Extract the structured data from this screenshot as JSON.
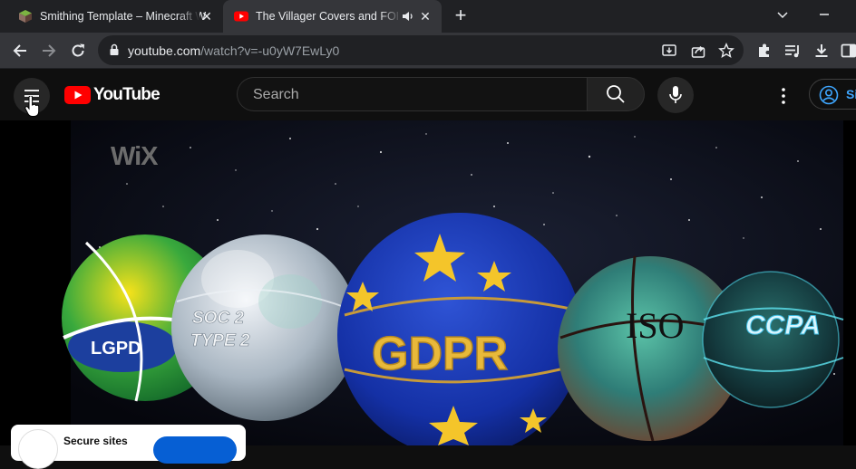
{
  "browser": {
    "tabs": [
      {
        "title": "Smithing Template – Minecraft W",
        "favicon": "minecraft-cube-icon",
        "active": false
      },
      {
        "title": "The Villager Covers and FOR",
        "favicon": "youtube-icon",
        "active": true,
        "audio": "speaker-icon"
      }
    ],
    "address": {
      "host": "youtube.com",
      "path": "/watch?v=-u0yW7EwLy0"
    },
    "colors": {
      "tabstrip": "#202124",
      "toolbar": "#35363a"
    }
  },
  "youtube": {
    "logo_text": "YouTube",
    "search_placeholder": "Search",
    "signin_label": "Si",
    "colors": {
      "brand_red": "#ff0000",
      "signin_blue": "#3ea6ff"
    }
  },
  "video": {
    "watermark": "WiX",
    "balls": [
      {
        "label": "LGPD"
      },
      {
        "label_line1": "SOC 2",
        "label_line2": "TYPE 2"
      },
      {
        "label": "GDPR"
      },
      {
        "label": "ISO"
      },
      {
        "label": "CCPA"
      }
    ]
  },
  "promo": {
    "text": "Secure sites"
  }
}
